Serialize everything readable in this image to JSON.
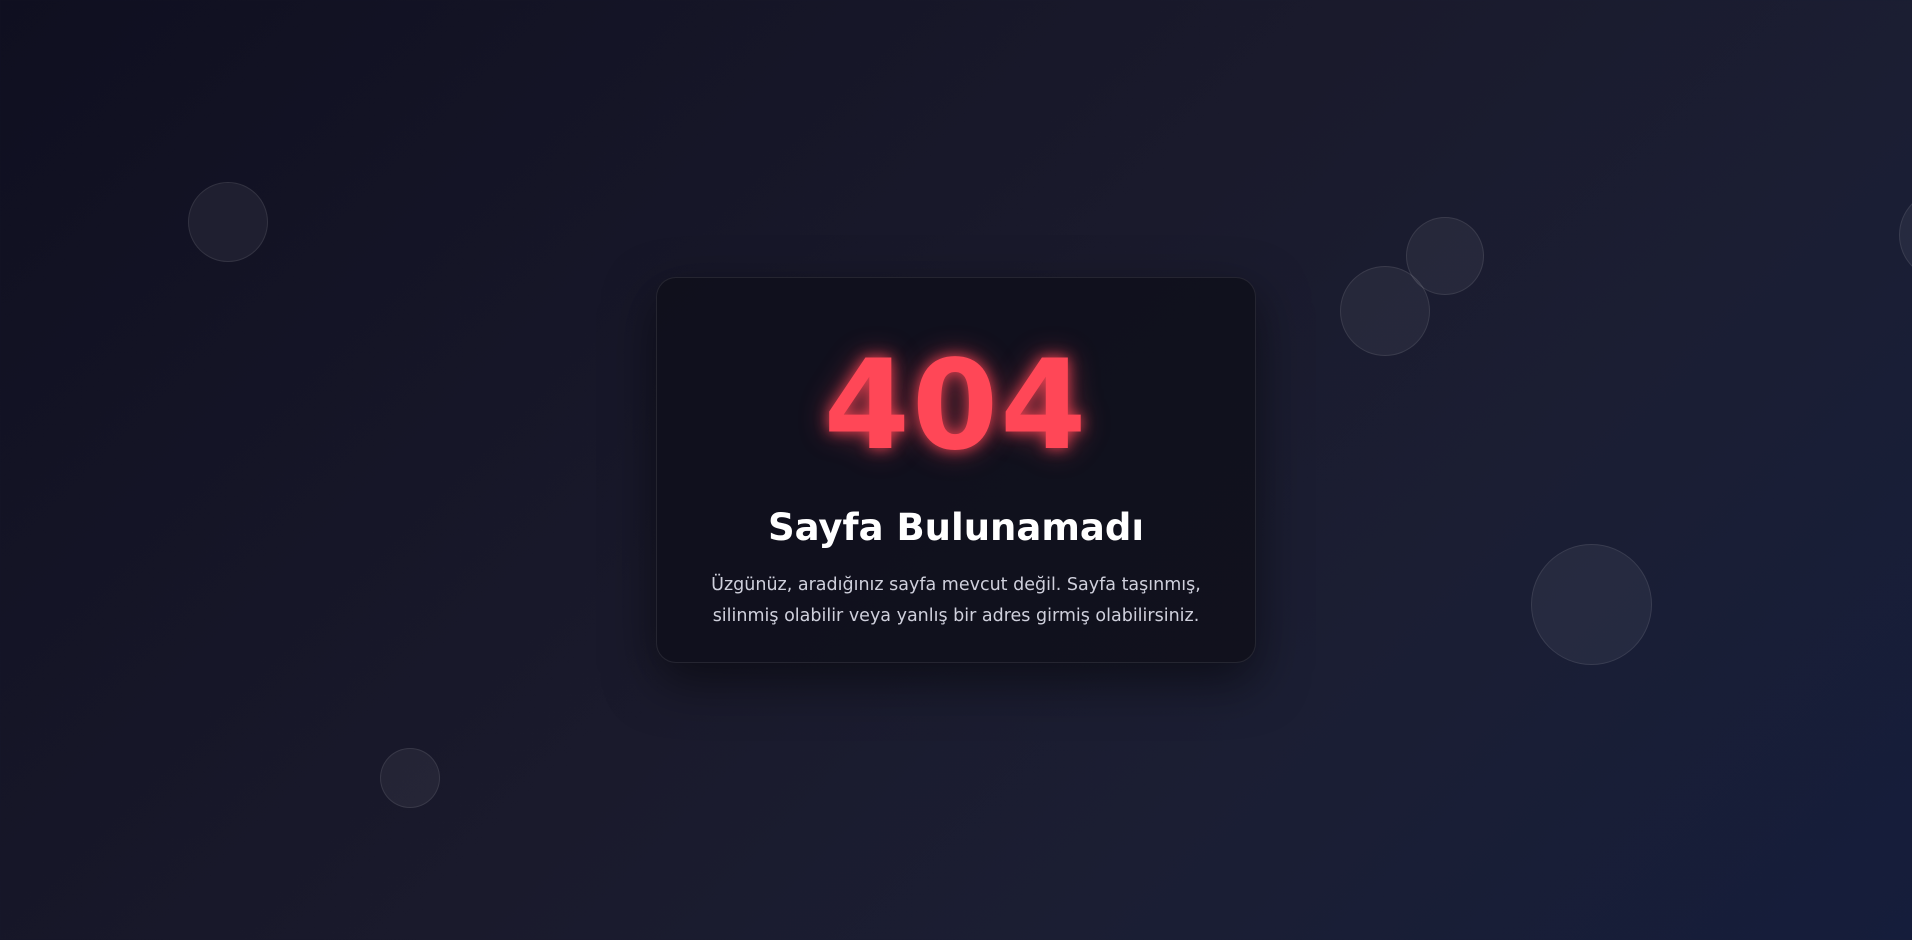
{
  "error": {
    "code": "404",
    "title": "Sayfa Bulunamadı",
    "message": "Üzgünüz, aradığınız sayfa mevcut değil. Sayfa taşınmış, silinmiş olabilir veya yanlış bir adres girmiş olabilirsiniz."
  },
  "colors": {
    "accent": "#ff4757",
    "background": "#14142a",
    "card": "#10101c",
    "title_text": "#ffffff",
    "body_text": "#cfd0dc"
  }
}
